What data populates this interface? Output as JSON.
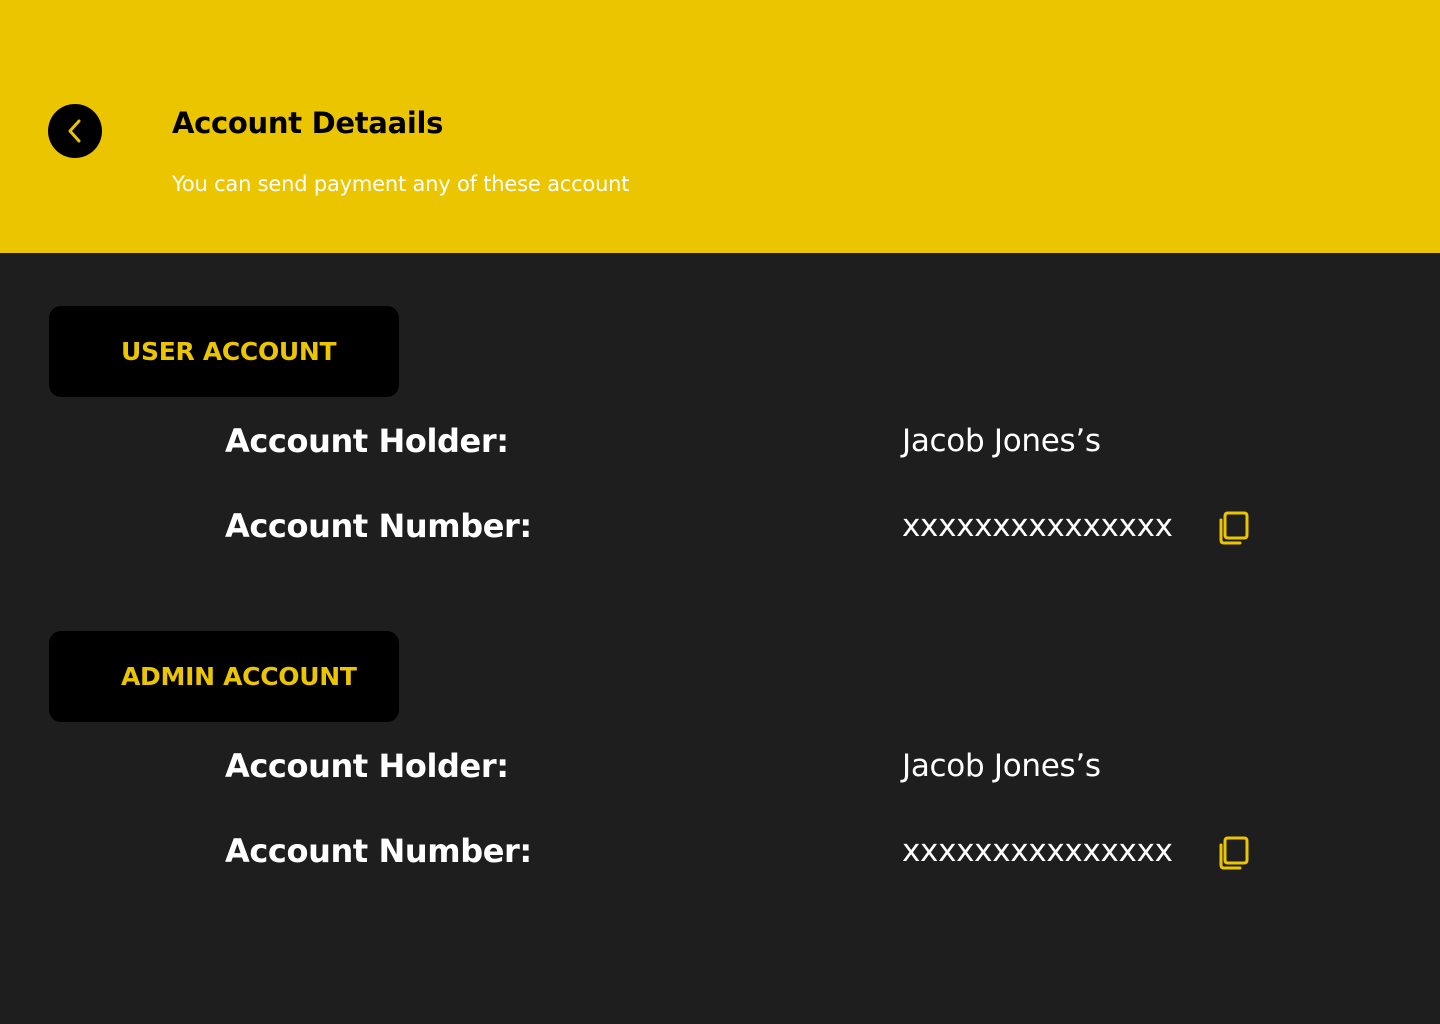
{
  "header": {
    "title": "Account Detaails",
    "subtitle": "You can send payment any of these account",
    "back_icon": "chevron-left-icon"
  },
  "accounts": [
    {
      "section_label": "USER ACCOUNT",
      "holder_label": "Account Holder:",
      "holder_value": "Jacob Jones’s",
      "number_label": "Account Number:",
      "number_value": "xxxxxxxxxxxxxxx",
      "copy_icon": "copy-icon"
    },
    {
      "section_label": "ADMIN ACCOUNT",
      "holder_label": "Account Holder:",
      "holder_value": "Jacob Jones’s",
      "number_label": "Account Number:",
      "number_value": "xxxxxxxxxxxxxxx",
      "copy_icon": "copy-icon"
    }
  ],
  "colors": {
    "accent": "#ebc500",
    "background": "#1e1e1e",
    "badge_background": "#000000",
    "text": "#ffffff"
  }
}
